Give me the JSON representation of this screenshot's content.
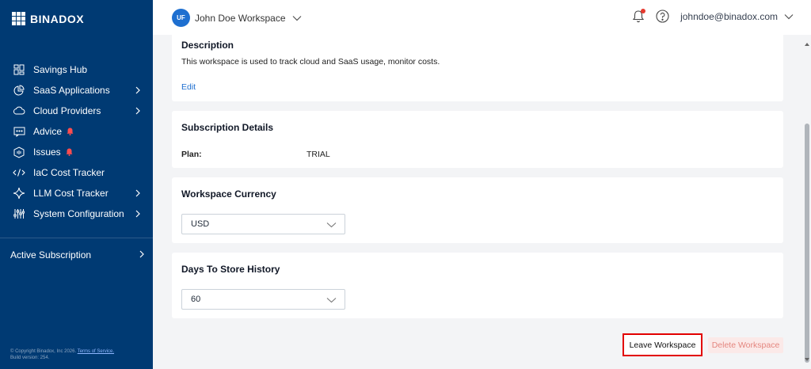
{
  "brand": {
    "name": "BINADOX"
  },
  "sidebar": {
    "items": [
      {
        "label": "Savings Hub",
        "icon": "dashboard-icon"
      },
      {
        "label": "SaaS Applications",
        "icon": "pie-chart-icon"
      },
      {
        "label": "Cloud Providers",
        "icon": "cloud-icon"
      },
      {
        "label": "Advice",
        "icon": "message-icon"
      },
      {
        "label": "Issues",
        "icon": "shield-icon"
      },
      {
        "label": "IaC Cost Tracker",
        "icon": "code-icon"
      },
      {
        "label": "LLM Cost Tracker",
        "icon": "sparkle-icon"
      },
      {
        "label": "System Configuration",
        "icon": "sliders-icon"
      }
    ],
    "active_subscription": "Active Subscription",
    "footer": {
      "copyright": "© Copyright Binadox, Inc 2026.",
      "terms": "Terms of Service.",
      "build": "Build version: 254."
    }
  },
  "header": {
    "avatar_initials": "UF",
    "workspace_name": "John Doe Workspace",
    "user_email": "johndoe@binadox.com"
  },
  "description": {
    "title": "Description",
    "text": "This workspace is used to track cloud and SaaS usage, monitor costs.",
    "edit_label": "Edit"
  },
  "subscription": {
    "title": "Subscription Details",
    "plan_label": "Plan:",
    "plan_value": "TRIAL"
  },
  "currency": {
    "title": "Workspace Currency",
    "value": "USD"
  },
  "history": {
    "title": "Days To Store History",
    "value": "60"
  },
  "actions": {
    "leave_label": "Leave Workspace",
    "delete_label": "Delete Workspace"
  },
  "colors": {
    "sidebar_bg": "#003a73",
    "accent": "#1e6fd0",
    "alert": "#e5392e",
    "highlight_border": "#e20000"
  }
}
